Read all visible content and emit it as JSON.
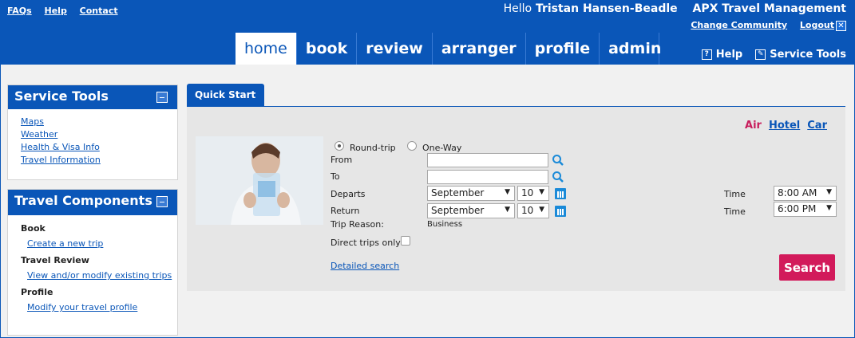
{
  "header": {
    "links": [
      "FAQs",
      "Help",
      "Contact"
    ],
    "greeting": "Hello",
    "user_name": "Tristan Hansen-Beadle",
    "app_name": "APX Travel Management",
    "change_community": "Change Community",
    "logout": "Logout"
  },
  "nav": {
    "tabs": [
      "home",
      "book",
      "review",
      "arranger",
      "profile",
      "admin"
    ],
    "active": "home",
    "help": "Help",
    "service_tools": "Service Tools"
  },
  "service_tools": {
    "title": "Service Tools",
    "links": [
      "Maps",
      "Weather",
      "Health & Visa Info",
      "Travel Information"
    ]
  },
  "travel_components": {
    "title": "Travel Components",
    "groups": [
      {
        "heading": "Book",
        "link": "Create a new trip"
      },
      {
        "heading": "Travel Review",
        "link": "View and/or modify existing trips"
      },
      {
        "heading": "Profile",
        "link": "Modify your travel profile"
      }
    ]
  },
  "quick_start": {
    "tab_label": "Quick Start",
    "modes": {
      "air": "Air",
      "hotel": "Hotel",
      "car": "Car"
    },
    "round_trip": "Round-trip",
    "one_way": "One-Way",
    "from_label": "From",
    "to_label": "To",
    "departs_label": "Departs",
    "return_label": "Return",
    "trip_reason_label": "Trip Reason:",
    "trip_reason_value": "Business",
    "direct_label": "Direct trips only",
    "detailed_search": "Detailed search",
    "time_label": "Time",
    "departs_month": "September",
    "departs_day": "10",
    "departs_time": "8:00 AM",
    "return_month": "September",
    "return_day": "10",
    "return_time": "6:00 PM",
    "search_button": "Search"
  },
  "colors": {
    "brand_blue": "#0a56b8",
    "search_pink": "#d21a5b",
    "air_pink": "#c81d5c"
  }
}
